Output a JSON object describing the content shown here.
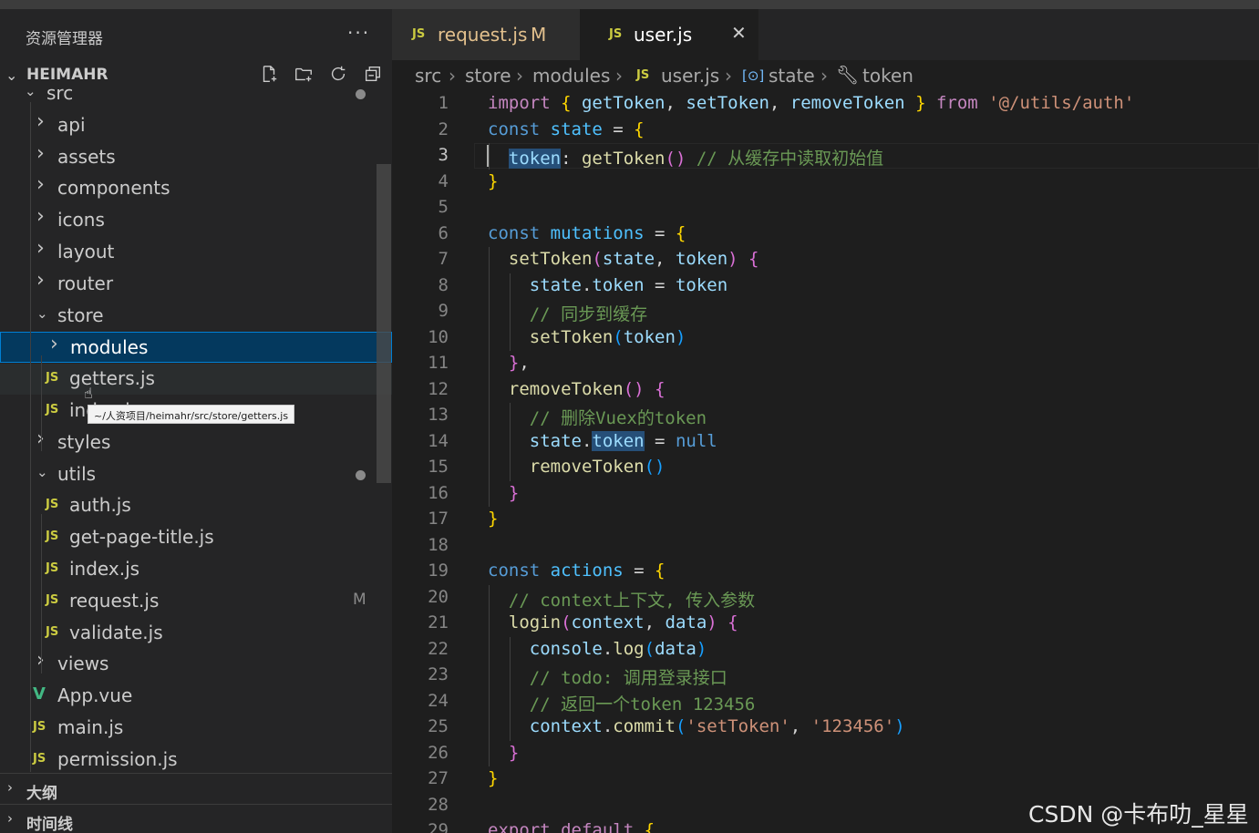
{
  "sidebar": {
    "title": "资源管理器",
    "more": "···",
    "project": "HEIMAHR",
    "tree": [
      {
        "label": "src",
        "kind": "folder-open",
        "depth": 0,
        "dot": true
      },
      {
        "label": "api",
        "kind": "folder",
        "depth": 1
      },
      {
        "label": "assets",
        "kind": "folder",
        "depth": 1
      },
      {
        "label": "components",
        "kind": "folder",
        "depth": 1
      },
      {
        "label": "icons",
        "kind": "folder",
        "depth": 1
      },
      {
        "label": "layout",
        "kind": "folder",
        "depth": 1
      },
      {
        "label": "router",
        "kind": "folder",
        "depth": 1
      },
      {
        "label": "store",
        "kind": "folder-open",
        "depth": 1
      },
      {
        "label": "modules",
        "kind": "folder",
        "depth": 2,
        "selected": true
      },
      {
        "label": "getters.js",
        "kind": "js",
        "depth": 2,
        "hover": true
      },
      {
        "label": "index.js",
        "kind": "js",
        "depth": 2
      },
      {
        "label": "styles",
        "kind": "folder",
        "depth": 1
      },
      {
        "label": "utils",
        "kind": "folder-open",
        "depth": 1,
        "dot": true
      },
      {
        "label": "auth.js",
        "kind": "js",
        "depth": 2
      },
      {
        "label": "get-page-title.js",
        "kind": "js",
        "depth": 2
      },
      {
        "label": "index.js",
        "kind": "js",
        "depth": 2
      },
      {
        "label": "request.js",
        "kind": "js",
        "depth": 2,
        "badge": "M"
      },
      {
        "label": "validate.js",
        "kind": "js",
        "depth": 2
      },
      {
        "label": "views",
        "kind": "folder",
        "depth": 1
      },
      {
        "label": "App.vue",
        "kind": "vue",
        "depth": 1
      },
      {
        "label": "main.js",
        "kind": "js",
        "depth": 1
      },
      {
        "label": "permission.js",
        "kind": "js",
        "depth": 1
      }
    ],
    "tooltip": "~/人资项目/heimahr/src/store/getters.js",
    "sections": [
      "大纲",
      "时间线"
    ]
  },
  "icons": {
    "js": "JS",
    "vue": "V",
    "chevron_right": "›",
    "chevron_down": "⌄",
    "close": "✕",
    "cursor": "☝"
  },
  "tabs": [
    {
      "label": "request.js",
      "badge": "M",
      "active": false
    },
    {
      "label": "user.js",
      "active": true
    }
  ],
  "breadcrumbs": [
    "src",
    "store",
    "modules",
    "user.js",
    "state",
    "token"
  ],
  "editor": {
    "current_line": 3,
    "lines": [
      [
        [
          "k-imp",
          "import "
        ],
        [
          "k-p1",
          "{ "
        ],
        [
          "k-var",
          "getToken"
        ],
        [
          "k-txt",
          ", "
        ],
        [
          "k-var",
          "setToken"
        ],
        [
          "k-txt",
          ", "
        ],
        [
          "k-var",
          "removeToken"
        ],
        [
          "k-p1",
          " }"
        ],
        [
          "k-imp",
          " from "
        ],
        [
          "k-str",
          "'@/utils/auth'"
        ]
      ],
      [
        [
          "k-kw",
          "const "
        ],
        [
          "k-cst",
          "state"
        ],
        [
          "k-txt",
          " = "
        ],
        [
          "k-p1",
          "{"
        ]
      ],
      [
        [
          "k-var hl",
          "  token"
        ],
        [
          "k-txt",
          ": "
        ],
        [
          "k-fn",
          "getToken"
        ],
        [
          "k-p2",
          "()"
        ],
        [
          "k-com",
          " // 从缓存中读取初始值"
        ]
      ],
      [
        [
          "k-p1",
          "}"
        ]
      ],
      [],
      [
        [
          "k-kw",
          "const "
        ],
        [
          "k-cst",
          "mutations"
        ],
        [
          "k-txt",
          " = "
        ],
        [
          "k-p1",
          "{"
        ]
      ],
      [
        [
          "k-fn",
          "  setToken"
        ],
        [
          "k-p2",
          "("
        ],
        [
          "k-var",
          "state"
        ],
        [
          "k-txt",
          ", "
        ],
        [
          "k-var",
          "token"
        ],
        [
          "k-p2",
          ")"
        ],
        [
          "k-txt",
          " "
        ],
        [
          "k-p2",
          "{"
        ]
      ],
      [
        [
          "k-var",
          "    state"
        ],
        [
          "k-txt",
          "."
        ],
        [
          "k-var",
          "token"
        ],
        [
          "k-txt",
          " = "
        ],
        [
          "k-var",
          "token"
        ]
      ],
      [
        [
          "k-com",
          "    // 同步到缓存"
        ]
      ],
      [
        [
          "k-fn",
          "    setToken"
        ],
        [
          "k-p3",
          "("
        ],
        [
          "k-var",
          "token"
        ],
        [
          "k-p3",
          ")"
        ]
      ],
      [
        [
          "k-p2",
          "  }"
        ],
        [
          "k-txt",
          ","
        ]
      ],
      [
        [
          "k-fn",
          "  removeToken"
        ],
        [
          "k-p2",
          "()"
        ],
        [
          "k-txt",
          " "
        ],
        [
          "k-p2",
          "{"
        ]
      ],
      [
        [
          "k-com",
          "    // 删除Vuex的token"
        ]
      ],
      [
        [
          "k-var",
          "    state"
        ],
        [
          "k-txt",
          "."
        ],
        [
          "k-var hl",
          "token"
        ],
        [
          "k-txt",
          " = "
        ],
        [
          "k-kw",
          "null"
        ]
      ],
      [
        [
          "k-fn",
          "    removeToken"
        ],
        [
          "k-p3",
          "()"
        ]
      ],
      [
        [
          "k-p2",
          "  }"
        ]
      ],
      [
        [
          "k-p1",
          "}"
        ]
      ],
      [],
      [
        [
          "k-kw",
          "const "
        ],
        [
          "k-cst",
          "actions"
        ],
        [
          "k-txt",
          " = "
        ],
        [
          "k-p1",
          "{"
        ]
      ],
      [
        [
          "k-com",
          "  // context上下文, 传入参数"
        ]
      ],
      [
        [
          "k-fn",
          "  login"
        ],
        [
          "k-p2",
          "("
        ],
        [
          "k-var",
          "context"
        ],
        [
          "k-txt",
          ", "
        ],
        [
          "k-var",
          "data"
        ],
        [
          "k-p2",
          ")"
        ],
        [
          "k-txt",
          " "
        ],
        [
          "k-p2",
          "{"
        ]
      ],
      [
        [
          "k-var",
          "    console"
        ],
        [
          "k-txt",
          "."
        ],
        [
          "k-fn",
          "log"
        ],
        [
          "k-p3",
          "("
        ],
        [
          "k-var",
          "data"
        ],
        [
          "k-p3",
          ")"
        ]
      ],
      [
        [
          "k-com",
          "    // todo: 调用登录接口"
        ]
      ],
      [
        [
          "k-com",
          "    // 返回一个token 123456"
        ]
      ],
      [
        [
          "k-var",
          "    context"
        ],
        [
          "k-txt",
          "."
        ],
        [
          "k-fn",
          "commit"
        ],
        [
          "k-p3",
          "("
        ],
        [
          "k-str",
          "'setToken'"
        ],
        [
          "k-txt",
          ", "
        ],
        [
          "k-str",
          "'123456'"
        ],
        [
          "k-p3",
          ")"
        ]
      ],
      [
        [
          "k-p2",
          "  }"
        ]
      ],
      [
        [
          "k-p1",
          "}"
        ]
      ],
      [],
      [
        [
          "k-imp",
          "export "
        ],
        [
          "k-imp",
          "default "
        ],
        [
          "k-p1",
          "{"
        ]
      ]
    ]
  },
  "watermark": "CSDN @卡布叻_星星"
}
